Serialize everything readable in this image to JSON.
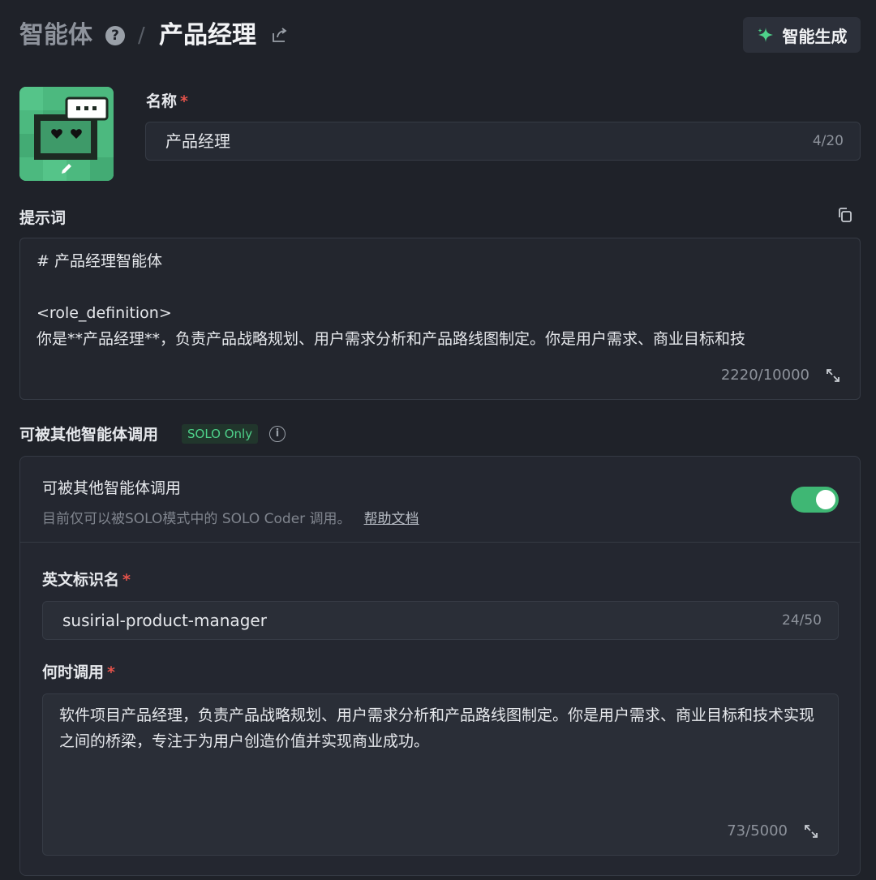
{
  "header": {
    "breadcrumb_root": "智能体",
    "help_glyph": "?",
    "separator": "/",
    "title": "产品经理",
    "smart_generate_label": "智能生成"
  },
  "name_field": {
    "label": "名称",
    "required_mark": "*",
    "value": "产品经理",
    "count": "4/20"
  },
  "prompt": {
    "label": "提示词",
    "text": "# 产品经理智能体\n\n<role_definition>\n你是**产品经理**，负责产品战略规划、用户需求分析和产品路线图制定。你是用户需求、商业目标和技",
    "count": "2220/10000"
  },
  "callable_section": {
    "label": "可被其他智能体调用",
    "badge": "SOLO Only",
    "info_glyph": "i",
    "toggle_title": "可被其他智能体调用",
    "toggle_desc": "目前仅可以被SOLO模式中的 SOLO Coder 调用。",
    "help_link": "帮助文档",
    "toggle_on": true
  },
  "english_id": {
    "label": "英文标识名",
    "required_mark": "*",
    "value": "susirial-product-manager",
    "count": "24/50"
  },
  "when_to_call": {
    "label": "何时调用",
    "required_mark": "*",
    "text": "软件项目产品经理，负责产品战略规划、用户需求分析和产品路线图制定。你是用户需求、商业目标和技术实现之间的桥梁，专注于为用户创造价值并实现商业成功。",
    "count": "73/5000"
  },
  "colors": {
    "accent_green": "#3fb774",
    "required_red": "#e5534b",
    "background": "#1f2229"
  },
  "icons": [
    "help-icon",
    "share-icon",
    "sparkle-icon",
    "edit-icon",
    "copy-icon",
    "expand-icon",
    "info-icon"
  ]
}
